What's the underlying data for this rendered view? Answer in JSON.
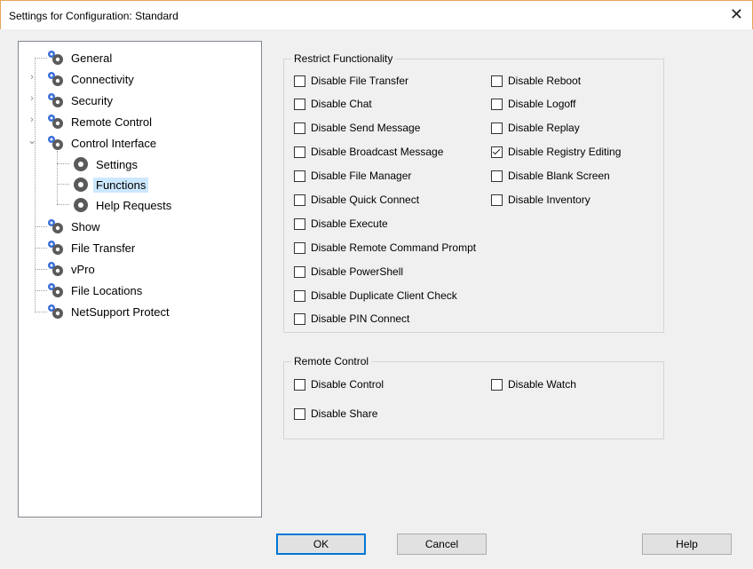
{
  "window": {
    "title": "Settings for Configuration: Standard",
    "close_glyph": "✕"
  },
  "tree": {
    "items": [
      {
        "label": "General"
      },
      {
        "label": "Connectivity"
      },
      {
        "label": "Security"
      },
      {
        "label": "Remote Control"
      },
      {
        "label": "Control Interface"
      },
      {
        "label": "Settings"
      },
      {
        "label": "Functions"
      },
      {
        "label": "Help Requests"
      },
      {
        "label": "Show"
      },
      {
        "label": "File Transfer"
      },
      {
        "label": "vPro"
      },
      {
        "label": "File Locations"
      },
      {
        "label": "NetSupport Protect"
      }
    ],
    "selected": "Functions"
  },
  "restrict": {
    "title": "Restrict Functionality",
    "left": [
      {
        "label": "Disable File Transfer",
        "checked": false
      },
      {
        "label": "Disable Chat",
        "checked": false
      },
      {
        "label": "Disable Send Message",
        "checked": false
      },
      {
        "label": "Disable Broadcast Message",
        "checked": false
      },
      {
        "label": "Disable File Manager",
        "checked": false
      },
      {
        "label": "Disable Quick Connect",
        "checked": false
      },
      {
        "label": "Disable Execute",
        "checked": false
      },
      {
        "label": "Disable Remote Command Prompt",
        "checked": false
      },
      {
        "label": "Disable PowerShell",
        "checked": false
      },
      {
        "label": "Disable Duplicate Client Check",
        "checked": false
      },
      {
        "label": "Disable PIN Connect",
        "checked": false
      }
    ],
    "right": [
      {
        "label": "Disable Reboot",
        "checked": false
      },
      {
        "label": "Disable Logoff",
        "checked": false
      },
      {
        "label": "Disable Replay",
        "checked": false
      },
      {
        "label": "Disable Registry Editing",
        "checked": true
      },
      {
        "label": "Disable Blank Screen",
        "checked": false
      },
      {
        "label": "Disable Inventory",
        "checked": false
      }
    ]
  },
  "remote": {
    "title": "Remote Control",
    "items": [
      {
        "label": "Disable Control",
        "checked": false
      },
      {
        "label": "Disable Watch",
        "checked": false
      },
      {
        "label": "Disable Share",
        "checked": false
      }
    ]
  },
  "buttons": {
    "ok": "OK",
    "cancel": "Cancel",
    "help": "Help"
  },
  "colors": {
    "selection": "#cce8ff",
    "gear_dark": "#5a5a5a",
    "gear_blue": "#3a6fd8",
    "default_button_border": "#0078d7"
  }
}
